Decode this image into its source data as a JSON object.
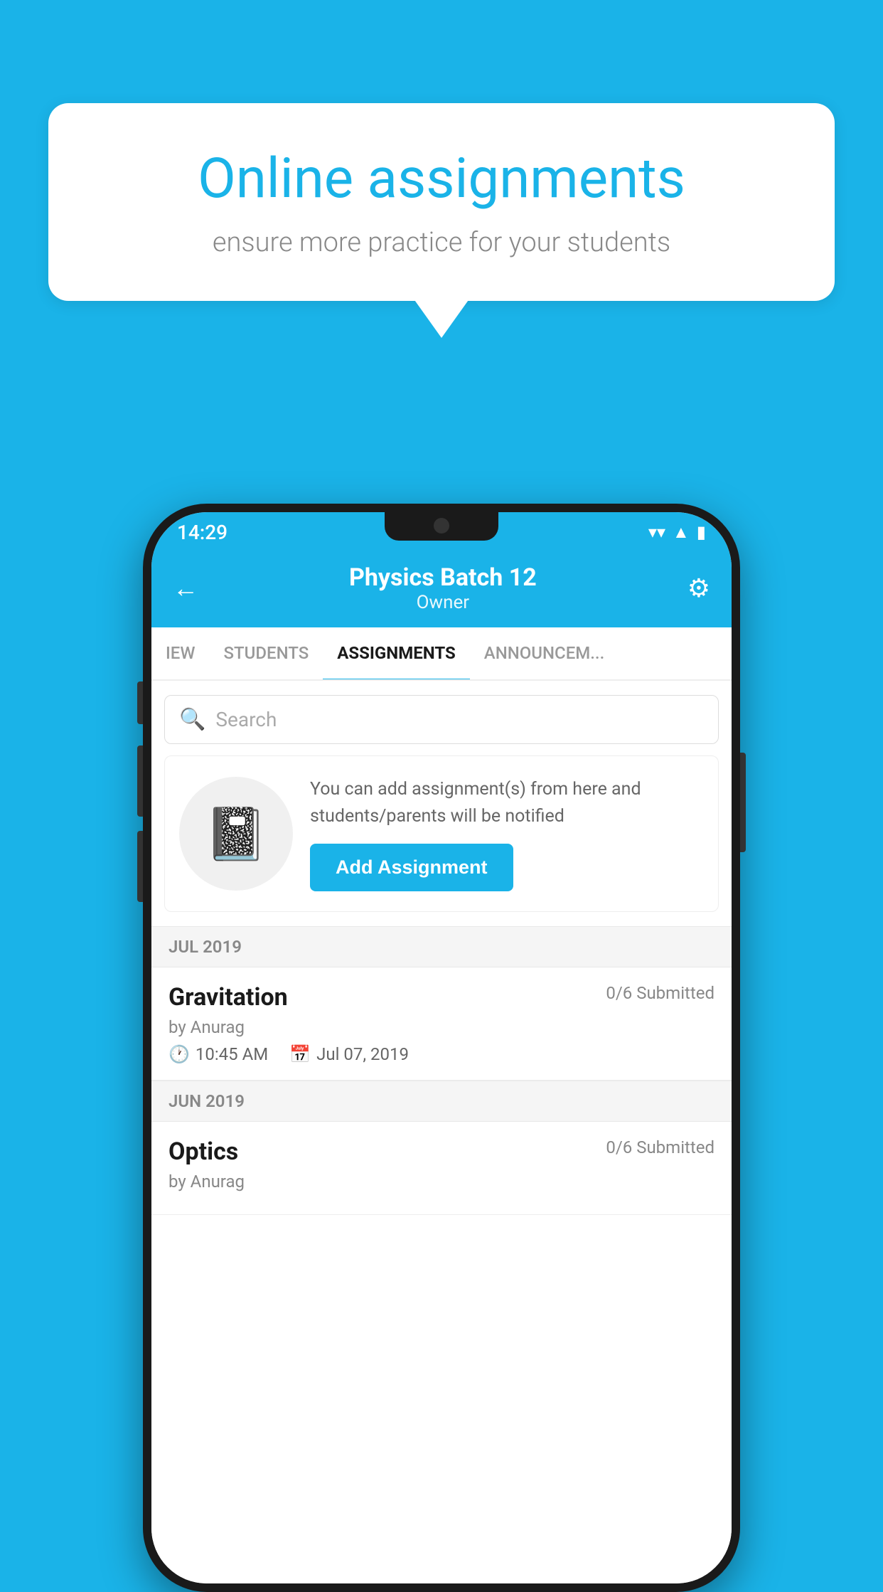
{
  "background_color": "#1ab3e8",
  "speech_bubble": {
    "title": "Online assignments",
    "subtitle": "ensure more practice for your students"
  },
  "status_bar": {
    "time": "14:29",
    "icons": [
      "wifi",
      "signal",
      "battery"
    ]
  },
  "header": {
    "title": "Physics Batch 12",
    "subtitle": "Owner",
    "back_label": "←",
    "settings_label": "⚙"
  },
  "tabs": [
    {
      "label": "IEW",
      "active": false
    },
    {
      "label": "STUDENTS",
      "active": false
    },
    {
      "label": "ASSIGNMENTS",
      "active": true
    },
    {
      "label": "ANNOUNCEM...",
      "active": false
    }
  ],
  "search": {
    "placeholder": "Search"
  },
  "empty_state": {
    "description": "You can add assignment(s) from here and students/parents will be notified",
    "button_label": "Add Assignment"
  },
  "sections": [
    {
      "label": "JUL 2019",
      "assignments": [
        {
          "name": "Gravitation",
          "submitted": "0/6 Submitted",
          "by": "by Anurag",
          "time": "10:45 AM",
          "date": "Jul 07, 2019"
        }
      ]
    },
    {
      "label": "JUN 2019",
      "assignments": [
        {
          "name": "Optics",
          "submitted": "0/6 Submitted",
          "by": "by Anurag",
          "time": "",
          "date": ""
        }
      ]
    }
  ]
}
